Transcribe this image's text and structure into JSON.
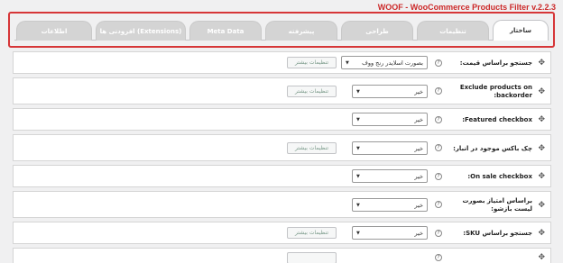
{
  "header": {
    "plugin_title": "WOOF - WooCommerce Products Filter v.2.2.3"
  },
  "tabs": [
    {
      "label": "ساختار",
      "active": true
    },
    {
      "label": "تنظیمات",
      "active": false
    },
    {
      "label": "طراحی",
      "active": false
    },
    {
      "label": "پیشرفته",
      "active": false
    },
    {
      "label": "Meta Data",
      "active": false
    },
    {
      "label": "افزودنی ها (Extensions)",
      "active": false
    },
    {
      "label": "اطلاعات",
      "active": false
    }
  ],
  "rows": [
    {
      "label": "جستجو براساس قیمت:",
      "value": "بصورت اسلایدر رنج ووف",
      "more": "تنظیمات بیشتر"
    },
    {
      "label": "Exclude products on backorder:",
      "value": "خیر",
      "more": "تنظیمات بیشتر"
    },
    {
      "label": "Featured checkbox:",
      "value": "خیر",
      "more": ""
    },
    {
      "label": "چک باکس موجود در انبار:",
      "value": "خیر",
      "more": "تنظیمات بیشتر"
    },
    {
      "label": "On sale checkbox:",
      "value": "خیر",
      "more": ""
    },
    {
      "label": "براساس امتیاز بصورت لیست بازشو:",
      "value": "خیر",
      "more": ""
    },
    {
      "label": "جستجو براساس SKU:",
      "value": "خیر",
      "more": "تنظیمات بیشتر"
    },
    {
      "label": "",
      "value": "",
      "more": ""
    }
  ],
  "icons": {
    "drag_handle": "move-arrows-icon",
    "help": "question-circle-icon",
    "dropdown": "caret-down-icon"
  },
  "colors": {
    "title_red": "#cc2a2a",
    "frame_red": "#d63638",
    "tab_inactive": "#d4d4d4"
  }
}
